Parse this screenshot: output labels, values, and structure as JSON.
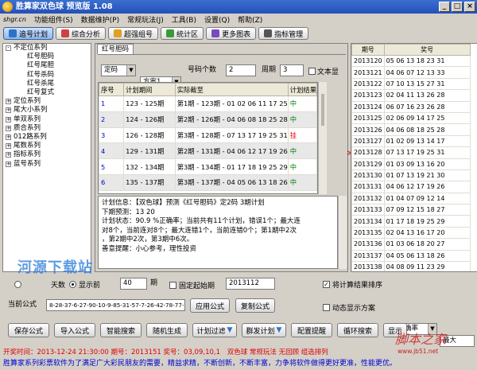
{
  "window": {
    "title": "胜算家双色球 预览版 1.08",
    "btn_min": "_",
    "btn_max": "□",
    "btn_close": "×"
  },
  "menu": {
    "brand": "shgr.cn",
    "items": [
      "功能组件(S)",
      "数据维护(P)",
      "常规玩法(J)",
      "工具(B)",
      "设置(Q)",
      "帮助(Z)"
    ]
  },
  "toolbar": [
    {
      "label": "追号计划",
      "active": true
    },
    {
      "label": "综合分析"
    },
    {
      "label": "超强组号"
    },
    {
      "label": "统计区"
    },
    {
      "label": "更多图表"
    },
    {
      "label": "指标管理"
    }
  ],
  "tree": [
    {
      "label": "不定位系列",
      "level": 1,
      "sign": "-"
    },
    {
      "label": "红号胆码",
      "level": 2
    },
    {
      "label": "红号尾胆",
      "level": 2
    },
    {
      "label": "红号杀码",
      "level": 2
    },
    {
      "label": "红号杀尾",
      "level": 2
    },
    {
      "label": "红号复式",
      "level": 2
    },
    {
      "label": "定位系列",
      "level": 1,
      "sign": "+"
    },
    {
      "label": "尾大小系列",
      "level": 1,
      "sign": "+"
    },
    {
      "label": "单双系列",
      "level": 1,
      "sign": "+"
    },
    {
      "label": "质合系列",
      "level": 1,
      "sign": "+"
    },
    {
      "label": "012路系列",
      "level": 1,
      "sign": "+"
    },
    {
      "label": "尾数系列",
      "level": 1,
      "sign": "+"
    },
    {
      "label": "指标系列",
      "level": 1,
      "sign": "+"
    },
    {
      "label": "蓝号系列",
      "level": 1,
      "sign": "+"
    }
  ],
  "tab": {
    "label": "红号胆码"
  },
  "controls": {
    "mode": "定码",
    "plan": "方案1",
    "count_label": "号码个数",
    "count": "2",
    "period_label": "周期",
    "period": "3",
    "text_label": "文本显"
  },
  "grid": {
    "headers": [
      "序号",
      "计划期间",
      "实际截至",
      "计划结果"
    ],
    "rows": [
      {
        "no": "1",
        "range": "123 - 125期",
        "actual": "第1期 - 123期 - 01 02 06 11 17 25",
        "result": "中",
        "type": "hit"
      },
      {
        "no": "2",
        "range": "124 - 126期",
        "actual": "第2期 - 126期 - 04 06 08 18 25 28",
        "result": "中",
        "type": "hit"
      },
      {
        "no": "3",
        "range": "126 - 128期",
        "actual": "第3期 - 128期 - 07 13 17 19 25 31",
        "result": "挂",
        "type": "miss"
      },
      {
        "no": "4",
        "range": "129 - 131期",
        "actual": "第2期 - 131期 - 04 06 12 17 19 26",
        "result": "中",
        "type": "hit"
      },
      {
        "no": "5",
        "range": "132 - 134期",
        "actual": "第3期 - 134期 - 01 17 18 19 25 29",
        "result": "中",
        "type": "hit"
      },
      {
        "no": "6",
        "range": "135 - 137期",
        "actual": "第3期 - 137期 - 04 05 06 13 18 26",
        "result": "中",
        "type": "hit"
      }
    ]
  },
  "info": {
    "lines": [
      "计划信息：【双色球】预测《红号胆码》定2码 3期计划",
      "下期预测：13 20",
      "计划状态：90.9 %正确率；当前共有11个计划，错误1个；最大连",
      "对8个，当前连对8个；最大连错1个，当前连错0个；第1期中2次",
      "，第2期中2次，第3期中6次。",
      "善意提醒：小心参考，理性投资"
    ]
  },
  "history": {
    "headers": [
      "期号",
      "奖号"
    ],
    "rows": [
      [
        "2013120",
        "05 06 13 18 23 31"
      ],
      [
        "2013121",
        "04 06 07 12 13 33"
      ],
      [
        "2013122",
        "07 10 13 15 27 31"
      ],
      [
        "2013123",
        "02 04 11 13 26 28"
      ],
      [
        "2013124",
        "06 07 16 23 26 28"
      ],
      [
        "2013125",
        "02 06 09 14 17 25"
      ],
      [
        "2013126",
        "04 06 08 18 25 28"
      ],
      [
        "2013127",
        "01 02 09 13 14 17"
      ],
      [
        "2013128",
        "07 13 17 19 25 31"
      ],
      [
        "2013129",
        "01 03 09 13 16 20"
      ],
      [
        "2013130",
        "01 07 13 19 21 30"
      ],
      [
        "2013131",
        "04 06 12 17 19 26"
      ],
      [
        "2013132",
        "01 04 07 09 12 14"
      ],
      [
        "2013133",
        "07 09 12 15 18 27"
      ],
      [
        "2013134",
        "01 17 18 19 25 29"
      ],
      [
        "2013135",
        "02 04 13 16 17 20"
      ],
      [
        "2013136",
        "01 03 06 18 20 27"
      ],
      [
        "2013137",
        "04 05 06 13 18 26"
      ],
      [
        "2013138",
        "04 08 09 11 23 29"
      ]
    ]
  },
  "bottom": {
    "radio1": "天数",
    "radio2": "显示前",
    "show_count": "40",
    "period_unit": "期",
    "fixed_start": "固定起始期",
    "start_issue": "2013112",
    "sort_label": "将计算结果排序",
    "formula_label": "当前公式",
    "formula": "8-28-37-6-27-90-10-9-85-31-57-7-26-42-78-77-87-3-47",
    "apply": "应用公式",
    "copy": "复制公式",
    "dynamic": "动态显示方案",
    "accuracy": "按正确率",
    "max": "最大",
    "buttons": [
      "保存公式",
      "导入公式",
      "智能搜索",
      "随机生成",
      "计划过滤",
      "群发计划",
      "配置提醒",
      "循环搜索",
      "显示"
    ]
  },
  "status": "开奖时间：2013-12-24 21:30:00 期号：2013151 奖号：03,09,10,1",
  "status_tags": "双色球  常规玩法  无回顾  组选排列",
  "marquee": "胜算家系列彩票软件为了满足广大彩民朋友的需要，精益求精，不断创新，不断丰富，力争将软件做得更好更准，性能更优。",
  "watermark": {
    "site": "河源下载站",
    "brand": "脚本之家",
    "url": "www.jb51.net"
  }
}
